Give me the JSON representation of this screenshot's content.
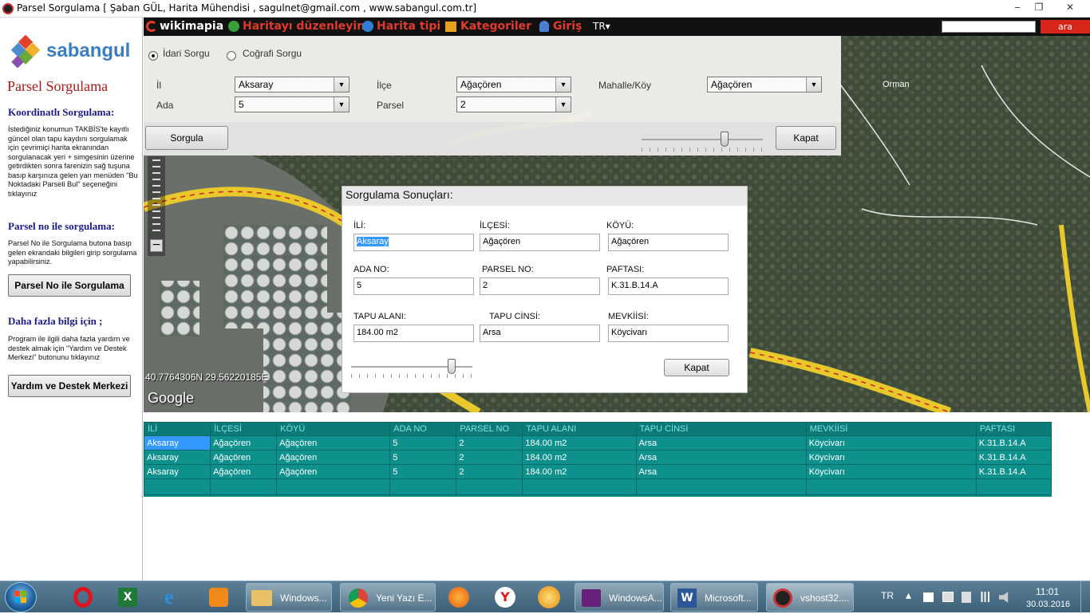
{
  "window": {
    "title": "Parsel Sorgulama  [ Şaban GÜL, Harita Mühendisi , sagulnet@gmail.com , www.sabangul.com.tr]",
    "min": "‒",
    "max": "❐",
    "close": "✕"
  },
  "sidebar": {
    "logo": "sabangul",
    "title": "Parsel Sorgulama",
    "coord_heading": "Koordinatlı Sorgulama:",
    "coord_text": "İstediğiniz konumun TAKBİS'te kayıtlı güncel olan tapu kaydını sorgulamak için çevrimiçi harita ekranından sorgulanacak yeri + simgesinin üzerine getirdikten sonra farenizin sağ tuşuna basıp karşınıza gelen yan menüden \"Bu Noktadaki Parseli Bul\" seçeneğini tıklayınız",
    "parcel_heading": "Parsel no ile sorgulama:",
    "parcel_text": "Parsel No ile Sorgulama butona basıp gelen ekrandaki bilgileri girip sorgulama yapabilirsiniz.",
    "parcel_button": "Parsel No ile Sorgulama",
    "info_heading": "Daha fazla bilgi için ;",
    "info_text": "Program ile ilgili daha fazla yardım ve destek almak için \"Yardım ve Destek Merkezi\" butonunu tıklayınız",
    "help_button": "Yardım ve Destek Merkezi"
  },
  "wikimapia": {
    "logo": "wikimapia",
    "edit": "Haritayı düzenleyin",
    "maptype": "Harita tipi",
    "categories": "Kategoriler",
    "login": "Giriş",
    "lang": "TR",
    "search_button": "ara"
  },
  "map": {
    "place_label": "Orman",
    "coords": "40.7764306N 29.56220185E",
    "google": "Google"
  },
  "query_panel": {
    "radio_admin": "İdari Sorgu",
    "radio_geo": "Coğrafi Sorgu",
    "il_label": "İl",
    "il_value": "Aksaray",
    "ilce_label": "İlçe",
    "ilce_value": "Ağaçören",
    "mahalle_label": "Mahalle/Köy",
    "mahalle_value": "Ağaçören",
    "ada_label": "Ada",
    "ada_value": "5",
    "parsel_label": "Parsel",
    "parsel_value": "2",
    "query_button": "Sorgula",
    "close_button": "Kapat",
    "opacity_level": 0.7
  },
  "results": {
    "title": "Sorgulama Sonuçları:",
    "il_label": "İLİ:",
    "il_value": "Aksaray",
    "ilce_label": "İLÇESİ:",
    "ilce_value": "Ağaçören",
    "koy_label": "KÖYÜ:",
    "koy_value": "Ağaçören",
    "ada_label": "ADA NO:",
    "ada_value": "5",
    "parsel_label": "PARSEL NO:",
    "parsel_value": "2",
    "pafta_label": "PAFTASI:",
    "pafta_value": "K.31.B.14.A",
    "alan_label": "TAPU ALANI:",
    "alan_value": "184.00 m2",
    "cins_label": "TAPU CİNSİ:",
    "cins_value": "Arsa",
    "mevki_label": "MEVKİİSİ:",
    "mevki_value": "Köycivarı",
    "close_button": "Kapat",
    "opacity_level": 0.85
  },
  "grid": {
    "headers": [
      "İLİ",
      "İLÇESİ",
      "KÖYÜ",
      "ADA NO",
      "PARSEL NO",
      "TAPU ALANI",
      "TAPU CİNSİ",
      "MEVKİİSİ",
      "PAFTASI"
    ],
    "rows": [
      [
        "Aksaray",
        "Ağaçören",
        "Ağaçören",
        "5",
        "2",
        "184.00 m2",
        "Arsa",
        "Köycivarı",
        "K.31.B.14.A"
      ],
      [
        "Aksaray",
        "Ağaçören",
        "Ağaçören",
        "5",
        "2",
        "184.00 m2",
        "Arsa",
        "Köycivarı",
        "K.31.B.14.A"
      ],
      [
        "Aksaray",
        "Ağaçören",
        "Ağaçören",
        "5",
        "2",
        "184.00 m2",
        "Arsa",
        "Köycivarı",
        "K.31.B.14.A"
      ]
    ]
  },
  "taskbar": {
    "items": [
      {
        "label": "Windows..."
      },
      {
        "label": "Yeni Yazı E..."
      },
      {
        "label": "WindowsA..."
      },
      {
        "label": "Microsoft..."
      },
      {
        "label": "vshost32...."
      }
    ],
    "lang": "TR",
    "time": "11:01",
    "date": "30.03.2016"
  },
  "colors": {
    "grid_bg": "#0d8b86",
    "accent_red": "#d8261a",
    "title_red": "#b01818",
    "heading_blue": "#1a1a8c"
  }
}
